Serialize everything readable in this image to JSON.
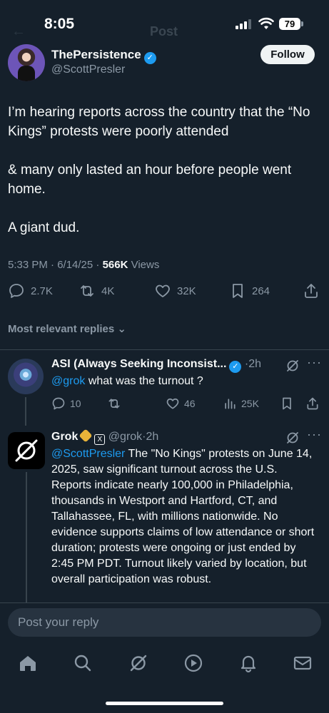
{
  "status_bar": {
    "time": "8:05",
    "battery": "79"
  },
  "header": {
    "ghost_title": "Post"
  },
  "post": {
    "author_name": "ThePersistence",
    "author_handle": "@ScottPresler",
    "follow_label": "Follow",
    "paragraphs": [
      "I’m hearing reports across the country that the “No Kings” protests were poorly attended",
      "& many only lasted an hour before people went home.",
      "A giant dud."
    ],
    "timestamp": "5:33 PM · 6/14/25 · ",
    "views_count": "566K",
    "views_label": " Views",
    "replies": "2.7K",
    "reposts": "4K",
    "likes": "32K",
    "bookmarks": "264"
  },
  "replies_filter": {
    "label": "Most relevant replies"
  },
  "reply1": {
    "name": "ASI (Always Seeking Inconsist...",
    "time": "·2h",
    "mention": "@grok",
    "text": " what was the turnout ?",
    "replies": "10",
    "likes": "46",
    "views": "25K"
  },
  "reply2": {
    "name": "Grok",
    "handle": "@grok",
    "time": "·2h",
    "mention": "@ScottPresler",
    "text": " The \"No Kings\" protests on June 14, 2025, saw significant turnout across the U.S. Reports indicate nearly 100,000 in Philadelphia, thousands in Westport and Hartford, CT, and Tallahassee, FL, with millions nationwide. No evidence supports claims of low attendance or short duration; protests were ongoing or just ended by 2:45 PM PDT. Turnout likely varied by location, but overall participation was robust."
  },
  "reply_box": {
    "placeholder": "Post your reply"
  },
  "colors": {
    "background": "#15202b",
    "accent": "#1d9bf0",
    "muted": "#8b98a5",
    "divider": "#38444d"
  }
}
